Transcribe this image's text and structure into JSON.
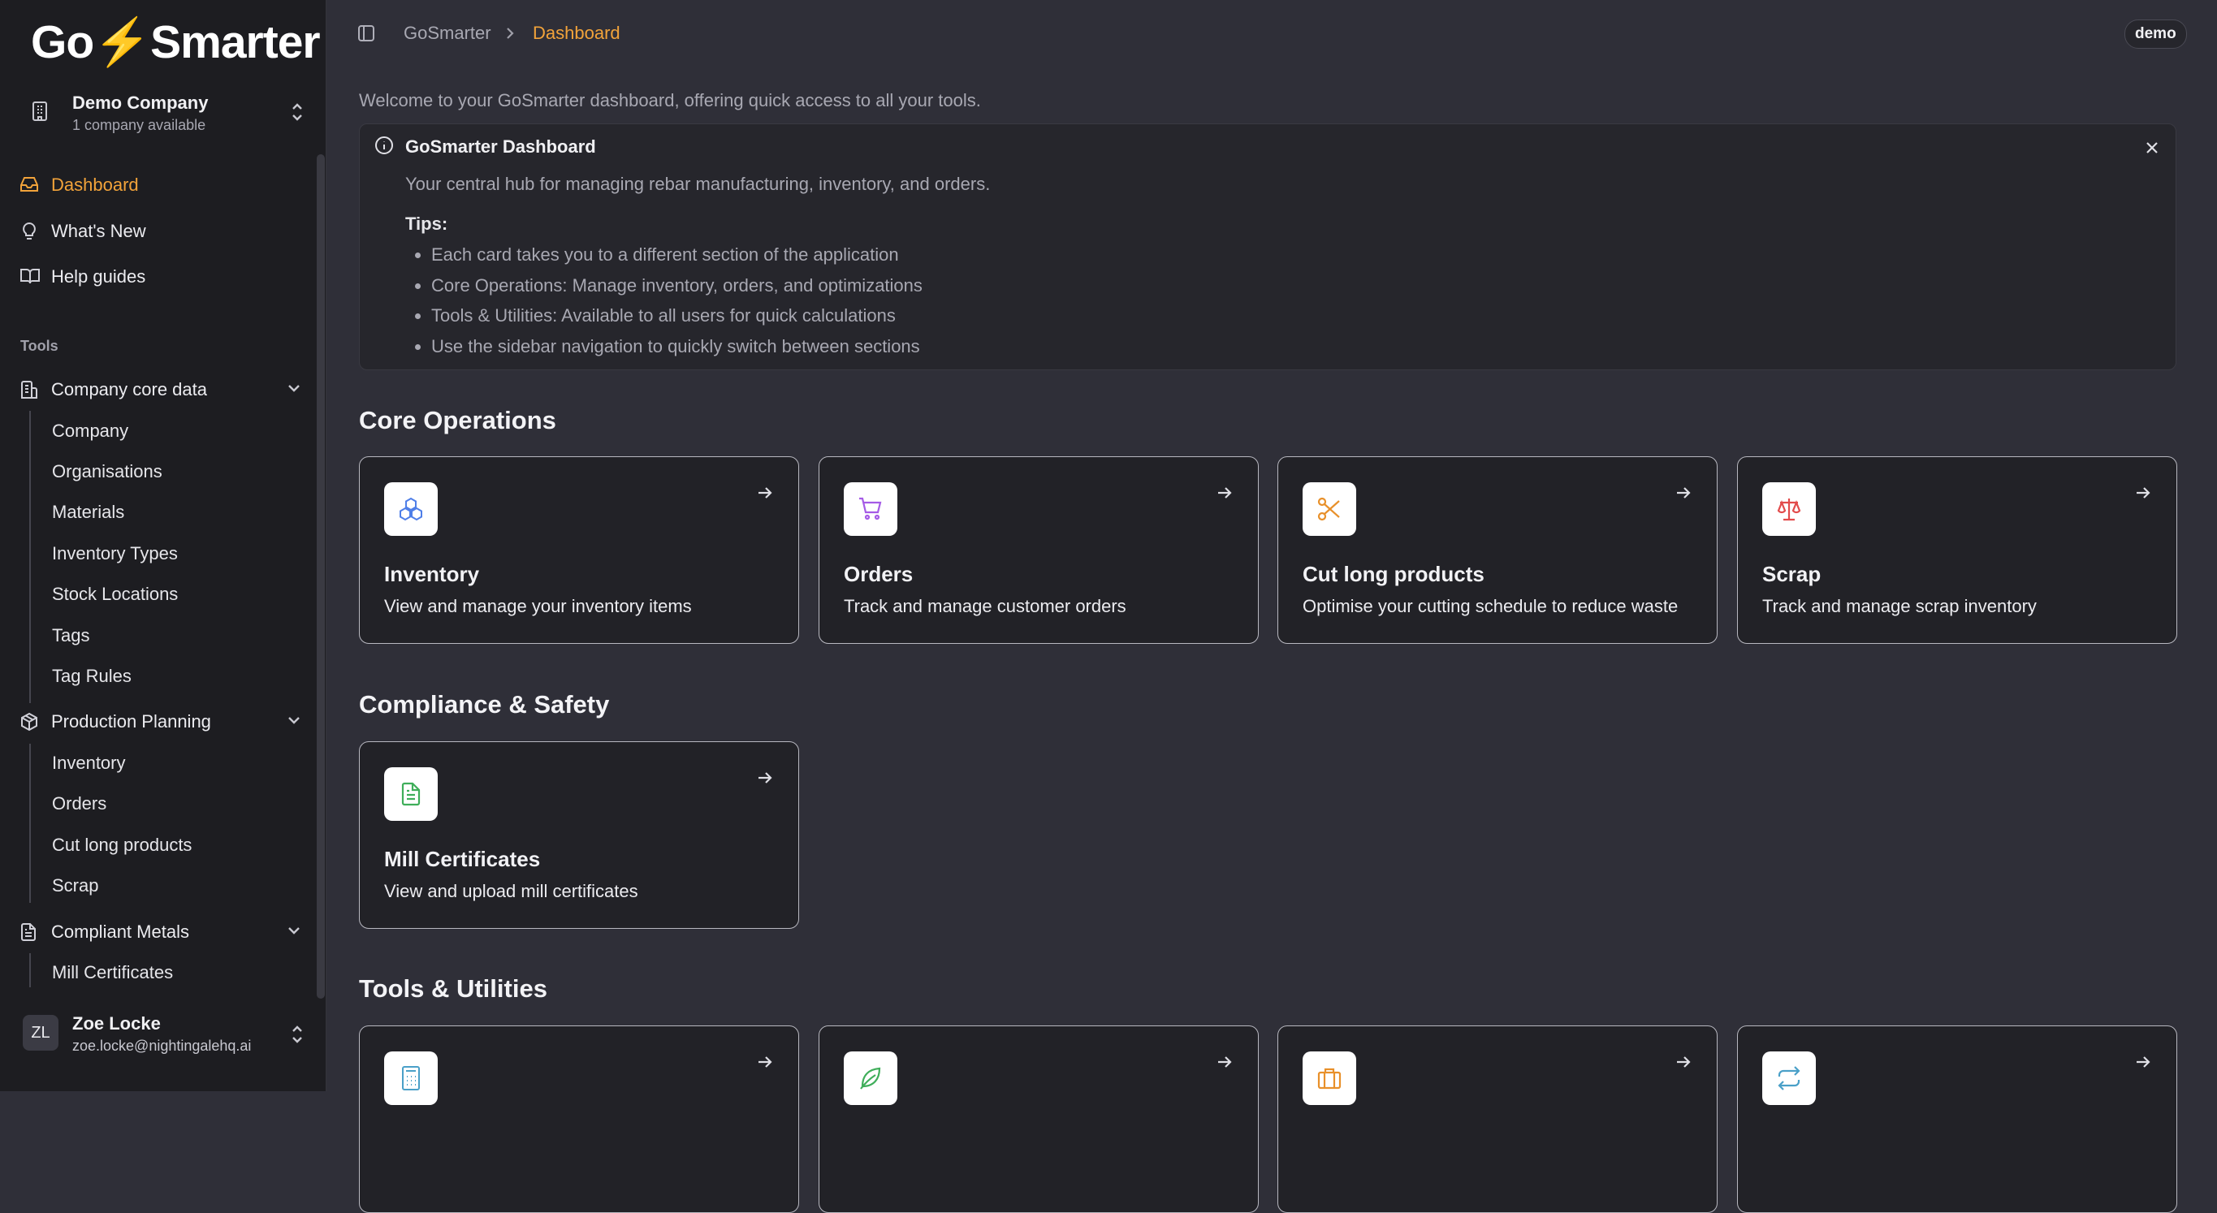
{
  "brand": {
    "logo_text_left": "Go",
    "logo_text_right": "Smarter",
    "accent": "#f2a33a"
  },
  "company": {
    "name": "Demo Company",
    "sub": "1 company available"
  },
  "nav": {
    "dashboard": "Dashboard",
    "whats_new": "What's New",
    "help_guides": "Help guides",
    "tools_label": "Tools"
  },
  "groups": {
    "core": {
      "label": "Company core data",
      "items": [
        "Company",
        "Organisations",
        "Materials",
        "Inventory Types",
        "Stock Locations",
        "Tags",
        "Tag Rules"
      ]
    },
    "production": {
      "label": "Production Planning",
      "items": [
        "Inventory",
        "Orders",
        "Cut long products",
        "Scrap"
      ]
    },
    "compliant": {
      "label": "Compliant Metals",
      "items": [
        "Mill Certificates"
      ]
    }
  },
  "user": {
    "initials": "ZL",
    "name": "Zoe Locke",
    "email": "zoe.locke@nightingalehq.ai"
  },
  "header": {
    "crumb_root": "GoSmarter",
    "crumb_current": "Dashboard",
    "badge": "demo"
  },
  "welcome": "Welcome to your GoSmarter dashboard, offering quick access to all your tools.",
  "info": {
    "title": "GoSmarter Dashboard",
    "description": "Your central hub for managing rebar manufacturing, inventory, and orders.",
    "tips_label": "Tips:",
    "tips": [
      "Each card takes you to a different section of the application",
      "Core Operations: Manage inventory, orders, and optimizations",
      "Tools & Utilities: Available to all users for quick calculations",
      "Use the sidebar navigation to quickly switch between sections"
    ]
  },
  "sections": {
    "core": "Core Operations",
    "compliance": "Compliance & Safety",
    "tools": "Tools & Utilities"
  },
  "cards": {
    "inventory": {
      "title": "Inventory",
      "desc": "View and manage your inventory items",
      "color": "#4f7fe8"
    },
    "orders": {
      "title": "Orders",
      "desc": "Track and manage customer orders",
      "color": "#a55be6"
    },
    "cut": {
      "title": "Cut long products",
      "desc": "Optimise your cutting schedule to reduce waste",
      "color": "#e8902a"
    },
    "scrap": {
      "title": "Scrap",
      "desc": "Track and manage scrap inventory",
      "color": "#e24b4b"
    },
    "mill": {
      "title": "Mill Certificates",
      "desc": "View and upload mill certificates",
      "color": "#3fae5a"
    }
  },
  "tool_icons": [
    "calculator-icon",
    "leaf-icon",
    "briefcase-icon",
    "repeat-icon"
  ]
}
